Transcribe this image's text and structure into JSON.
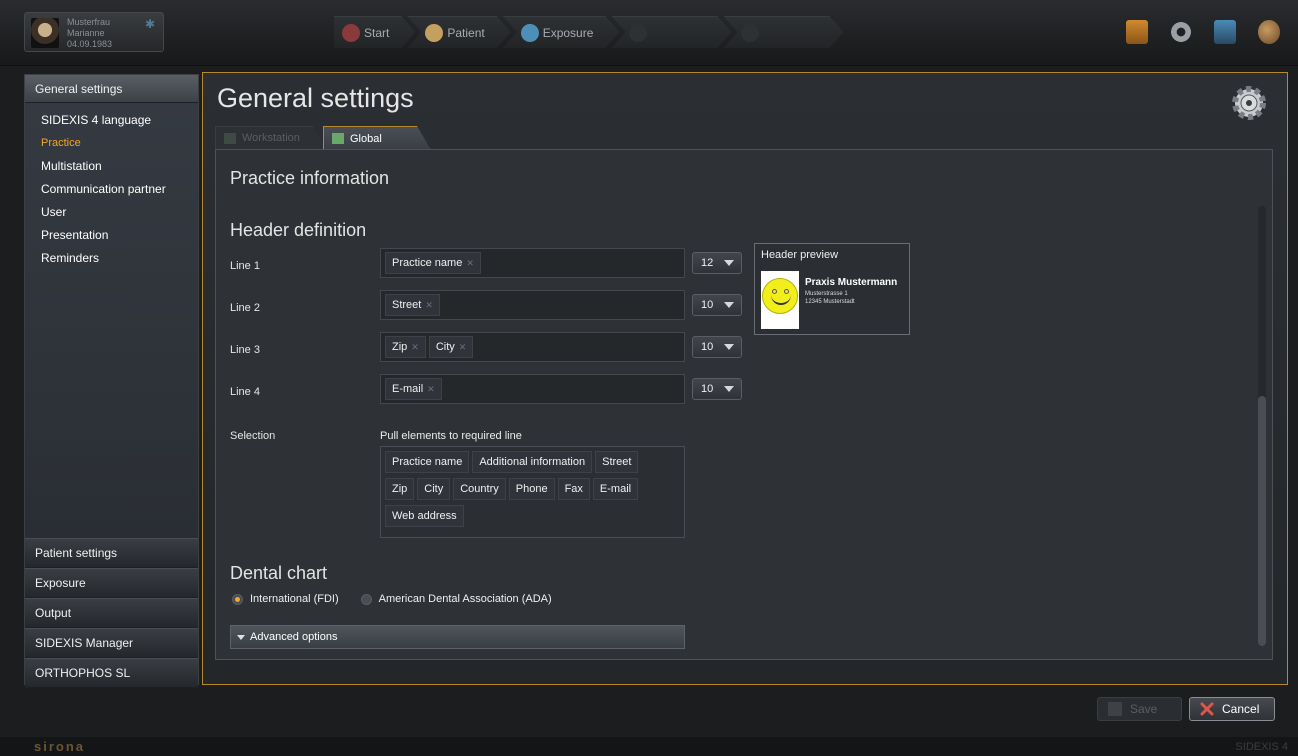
{
  "patient": {
    "last_name": "Musterfrau",
    "first_name": "Marianne",
    "dob": "04.09.1983"
  },
  "workflow": [
    {
      "label": "Start",
      "icon": "start-icon",
      "color": "#8a3a3a"
    },
    {
      "label": "Patient",
      "icon": "patient-icon",
      "color": "#c4a060"
    },
    {
      "label": "Exposure",
      "icon": "exposure-icon",
      "color": "#4e8fb8"
    },
    {
      "label": "",
      "icon": "examine-icon",
      "color": "#3a3d40"
    },
    {
      "label": "",
      "icon": "output-icon",
      "color": "#3a3d40"
    }
  ],
  "sidebar": {
    "head": "General settings",
    "items": [
      {
        "label": "SIDEXIS 4 language",
        "active": false
      },
      {
        "label": "Practice",
        "active": true
      },
      {
        "label": "Multistation",
        "active": false
      },
      {
        "label": "Communication partner",
        "active": false
      },
      {
        "label": "User",
        "active": false
      },
      {
        "label": "Presentation",
        "active": false
      },
      {
        "label": "Reminders",
        "active": false
      }
    ],
    "bottom": [
      "Patient settings",
      "Exposure",
      "Output",
      "SIDEXIS Manager",
      "ORTHOPHOS SL"
    ]
  },
  "main": {
    "title": "General settings",
    "tabs": {
      "workstation": "Workstation",
      "global": "Global"
    },
    "practice_info": "Practice information",
    "header_definition": "Header definition",
    "lines": [
      {
        "label": "Line 1",
        "chips": [
          "Practice name"
        ],
        "size": "12"
      },
      {
        "label": "Line 2",
        "chips": [
          "Street"
        ],
        "size": "10"
      },
      {
        "label": "Line 3",
        "chips": [
          "Zip",
          "City"
        ],
        "size": "10"
      },
      {
        "label": "Line 4",
        "chips": [
          "E-mail"
        ],
        "size": "10"
      }
    ],
    "preview": {
      "title": "Header preview",
      "practice": "Praxis Mustermann",
      "street": "Musterstrasse 1",
      "city": "12345 Musterstadt"
    },
    "selection": {
      "label": "Selection",
      "hint": "Pull elements to required line",
      "rows": [
        [
          "Practice name",
          "Additional information",
          "Street"
        ],
        [
          "Zip",
          "City",
          "Country",
          "Phone",
          "Fax",
          "E-mail"
        ],
        [
          "Web address"
        ]
      ]
    },
    "dental_chart": {
      "title": "Dental chart",
      "opt1": "International (FDI)",
      "opt2": "American Dental Association (ADA)",
      "selected": "opt1"
    },
    "advanced": "Advanced options"
  },
  "buttons": {
    "save": "Save",
    "cancel": "Cancel"
  },
  "footer": {
    "brand": "sirona",
    "version": "SIDEXIS 4"
  },
  "colors": {
    "accent": "#f5a623",
    "border_accent": "#b8892c"
  }
}
